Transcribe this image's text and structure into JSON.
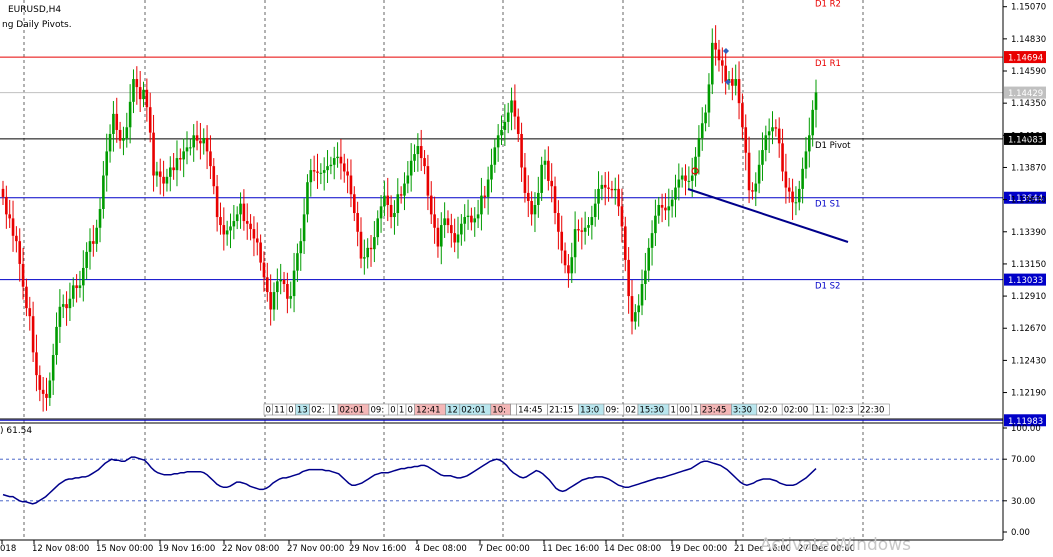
{
  "window": {
    "symbol_label": "EURUSD,H4",
    "indicator_label": "ng Daily Pivots.",
    "rsi_label": ") 61.54",
    "watermark": "Activate Windows"
  },
  "colors": {
    "bull": "#009b00",
    "bear": "#e80000",
    "grid": "#000000",
    "pivot": "#000000",
    "resistance": "#e80000",
    "support": "#0000c8",
    "trendline": "#00008b",
    "rsi_line": "#00008b"
  },
  "price_axis": {
    "ticks": [
      "1.15070",
      "1.14830",
      "1.14590",
      "1.14350",
      "1.14110",
      "1.13870",
      "1.13630",
      "1.13390",
      "1.13150",
      "1.12910",
      "1.12670",
      "1.12430",
      "1.12190"
    ],
    "current_price": "1.14429",
    "range": [
      1.12,
      1.1512
    ]
  },
  "pivot_levels": [
    {
      "name": "D1 R2",
      "value": 1.1514,
      "tag": "",
      "color": "resistance",
      "label": "D1 R2"
    },
    {
      "name": "D1 R1",
      "value": 1.14694,
      "tag": "1.14694",
      "color": "resistance",
      "label": "D1 R1"
    },
    {
      "name": "D1 Pivot",
      "value": 1.14083,
      "tag": "1.14083",
      "color": "pivot",
      "label": "D1 Pivot"
    },
    {
      "name": "D1 S1",
      "value": 1.13644,
      "tag": "1.13644",
      "color": "support",
      "label": "D1 S1"
    },
    {
      "name": "D1 S2",
      "value": 1.13033,
      "tag": "1.13033",
      "color": "support",
      "label": "D1 S2"
    },
    {
      "name": "",
      "value": 1.11983,
      "tag": "1.11983",
      "color": "support",
      "label": ""
    }
  ],
  "time_axis": {
    "labels": [
      "018",
      "12 Nov 08:00",
      "15 Nov 00:00",
      "19 Nov 16:00",
      "22 Nov 08:00",
      "27 Nov 00:00",
      "29 Nov 16:00",
      "4 Dec 08:00",
      "7 Dec 00:00",
      "11 Dec 16:00",
      "14 Dec 08:00",
      "19 Dec 00:00",
      "21 Dec 16:00",
      "27 Dec 00:00"
    ]
  },
  "session_boxes": [
    {
      "text": "0",
      "type": "n"
    },
    {
      "text": "11",
      "type": "n"
    },
    {
      "text": "0",
      "type": "n"
    },
    {
      "text": "13",
      "type": "b"
    },
    {
      "text": "02:",
      "type": "n"
    },
    {
      "text": "1",
      "type": "n"
    },
    {
      "text": "02:01",
      "type": "r"
    },
    {
      "text": "09:",
      "type": "n"
    },
    {
      "text": "0",
      "type": "n"
    },
    {
      "text": "1",
      "type": "n"
    },
    {
      "text": "0",
      "type": "n"
    },
    {
      "text": "12:41",
      "type": "r"
    },
    {
      "text": "12",
      "type": "b"
    },
    {
      "text": "02:01",
      "type": "b"
    },
    {
      "text": "10:",
      "type": "r"
    },
    {
      "text": "",
      "type": "n"
    },
    {
      "text": "14:45",
      "type": "n"
    },
    {
      "text": "21:15",
      "type": "n"
    },
    {
      "text": "13:0",
      "type": "b"
    },
    {
      "text": "09:",
      "type": "n"
    },
    {
      "text": "02",
      "type": "n"
    },
    {
      "text": "15:30",
      "type": "b"
    },
    {
      "text": "1",
      "type": "n"
    },
    {
      "text": "00",
      "type": "n"
    },
    {
      "text": "1",
      "type": "n"
    },
    {
      "text": "23:45",
      "type": "r"
    },
    {
      "text": "3:30",
      "type": "b"
    },
    {
      "text": "02:0",
      "type": "n"
    },
    {
      "text": "02:00",
      "type": "n"
    },
    {
      "text": "11:",
      "type": "n"
    },
    {
      "text": "02:3",
      "type": "n"
    },
    {
      "text": "22:30",
      "type": "n"
    }
  ],
  "rsi_axis": {
    "ticks": [
      "100.00",
      "70.00",
      "30.00",
      "0.00"
    ],
    "levels": [
      70,
      30
    ]
  },
  "chart_data": {
    "type": "candlestick",
    "symbol": "EURUSD",
    "timeframe": "H4",
    "closes": [
      1.1365,
      1.1352,
      1.1349,
      1.1336,
      1.1332,
      1.1315,
      1.1298,
      1.1282,
      1.1276,
      1.1249,
      1.1232,
      1.1221,
      1.1218,
      1.1215,
      1.1228,
      1.1247,
      1.1268,
      1.1283,
      1.1285,
      1.1282,
      1.1289,
      1.1299,
      1.1297,
      1.1299,
      1.1312,
      1.1324,
      1.1332,
      1.133,
      1.1342,
      1.1356,
      1.1381,
      1.1399,
      1.1412,
      1.1427,
      1.1415,
      1.1407,
      1.1409,
      1.1417,
      1.1436,
      1.1453,
      1.1447,
      1.1438,
      1.1445,
      1.1432,
      1.1413,
      1.1381,
      1.1384,
      1.138,
      1.1375,
      1.138,
      1.1387,
      1.1385,
      1.1394,
      1.1393,
      1.1399,
      1.1402,
      1.1402,
      1.1411,
      1.1407,
      1.1405,
      1.1409,
      1.1399,
      1.1388,
      1.1373,
      1.135,
      1.1344,
      1.1337,
      1.134,
      1.1343,
      1.1347,
      1.1352,
      1.136,
      1.1347,
      1.1345,
      1.1341,
      1.1334,
      1.1331,
      1.1316,
      1.1305,
      1.1294,
      1.1281,
      1.1294,
      1.1302,
      1.1303,
      1.13,
      1.1289,
      1.1291,
      1.131,
      1.1323,
      1.1332,
      1.1352,
      1.1376,
      1.1385,
      1.1384,
      1.1383,
      1.1383,
      1.1385,
      1.1388,
      1.1389,
      1.1394,
      1.1395,
      1.139,
      1.1384,
      1.1381,
      1.1367,
      1.1353,
      1.1339,
      1.1319,
      1.132,
      1.1327,
      1.1326,
      1.1335,
      1.1349,
      1.1358,
      1.1366,
      1.1359,
      1.135,
      1.1353,
      1.1367,
      1.1366,
      1.1375,
      1.1381,
      1.1392,
      1.1397,
      1.1403,
      1.1394,
      1.1388,
      1.1366,
      1.1352,
      1.1342,
      1.1328,
      1.1344,
      1.1349,
      1.1344,
      1.1338,
      1.1331,
      1.1337,
      1.1345,
      1.135,
      1.1351,
      1.1346,
      1.1349,
      1.1352,
      1.1366,
      1.1365,
      1.1378,
      1.1389,
      1.1402,
      1.1411,
      1.1415,
      1.1421,
      1.1428,
      1.1437,
      1.1425,
      1.1412,
      1.1387,
      1.1368,
      1.1362,
      1.1352,
      1.1359,
      1.1368,
      1.1389,
      1.1392,
      1.1377,
      1.1373,
      1.1353,
      1.1339,
      1.1325,
      1.1314,
      1.1308,
      1.132,
      1.1341,
      1.134,
      1.1339,
      1.1342,
      1.1344,
      1.135,
      1.136,
      1.1371,
      1.1374,
      1.1372,
      1.1371,
      1.137,
      1.1371,
      1.1358,
      1.1343,
      1.1318,
      1.1291,
      1.1272,
      1.1279,
      1.1284,
      1.13,
      1.131,
      1.1327,
      1.1338,
      1.1351,
      1.1359,
      1.1357,
      1.1355,
      1.1358,
      1.1363,
      1.1372,
      1.1378,
      1.1381,
      1.1377,
      1.1377,
      1.1381,
      1.1395,
      1.1409,
      1.142,
      1.1428,
      1.1449,
      1.148,
      1.1475,
      1.1467,
      1.1463,
      1.1451,
      1.1453,
      1.1448,
      1.1453,
      1.1435,
      1.1417,
      1.1398,
      1.137,
      1.1369,
      1.1375,
      1.1389,
      1.14,
      1.1411,
      1.1414,
      1.1417,
      1.1416,
      1.1405,
      1.1384,
      1.1372,
      1.1369,
      1.1361,
      1.1361,
      1.1371,
      1.1386,
      1.1399,
      1.1411,
      1.143,
      1.1443
    ],
    "rsi": [
      36,
      35,
      34,
      34,
      32,
      30,
      29,
      29,
      28,
      27,
      28,
      30,
      32,
      34,
      37,
      40,
      43,
      46,
      48,
      50,
      51,
      51,
      52,
      52,
      53,
      53,
      54,
      56,
      58,
      60,
      63,
      66,
      68,
      70,
      69,
      69,
      68,
      68,
      70,
      72,
      72,
      71,
      70,
      69,
      66,
      62,
      59,
      57,
      56,
      55,
      55,
      55,
      56,
      56,
      57,
      57,
      58,
      58,
      58,
      58,
      58,
      57,
      55,
      52,
      49,
      46,
      44,
      43,
      43,
      44,
      46,
      48,
      48,
      47,
      46,
      44,
      43,
      42,
      41,
      41,
      42,
      44,
      47,
      49,
      51,
      52,
      52,
      53,
      54,
      55,
      56,
      58,
      59,
      60,
      60,
      60,
      60,
      60,
      59,
      59,
      58,
      57,
      56,
      53,
      50,
      47,
      45,
      45,
      46,
      47,
      49,
      51,
      53,
      55,
      56,
      57,
      57,
      57,
      58,
      59,
      60,
      61,
      61,
      62,
      62,
      63,
      63,
      64,
      64,
      63,
      61,
      59,
      57,
      55,
      54,
      54,
      54,
      53,
      52,
      52,
      53,
      54,
      56,
      58,
      60,
      62,
      64,
      66,
      68,
      69,
      70,
      69,
      67,
      64,
      60,
      57,
      55,
      53,
      52,
      53,
      55,
      57,
      59,
      58,
      56,
      53,
      50,
      46,
      42,
      40,
      39,
      40,
      42,
      44,
      46,
      48,
      50,
      51,
      52,
      52,
      53,
      53,
      53,
      52,
      51,
      49,
      47,
      45,
      44,
      43,
      43,
      44,
      45,
      46,
      47,
      48,
      49,
      50,
      51,
      52,
      52,
      53,
      54,
      55,
      56,
      57,
      58,
      59,
      60,
      61,
      63,
      65,
      67,
      68,
      68,
      67,
      66,
      65,
      64,
      62,
      60,
      57,
      54,
      51,
      48,
      46,
      45,
      46,
      47,
      49,
      50,
      51,
      51,
      51,
      50,
      49,
      47,
      46,
      45,
      45,
      45,
      46,
      48,
      50,
      52,
      55,
      58,
      61
    ]
  }
}
